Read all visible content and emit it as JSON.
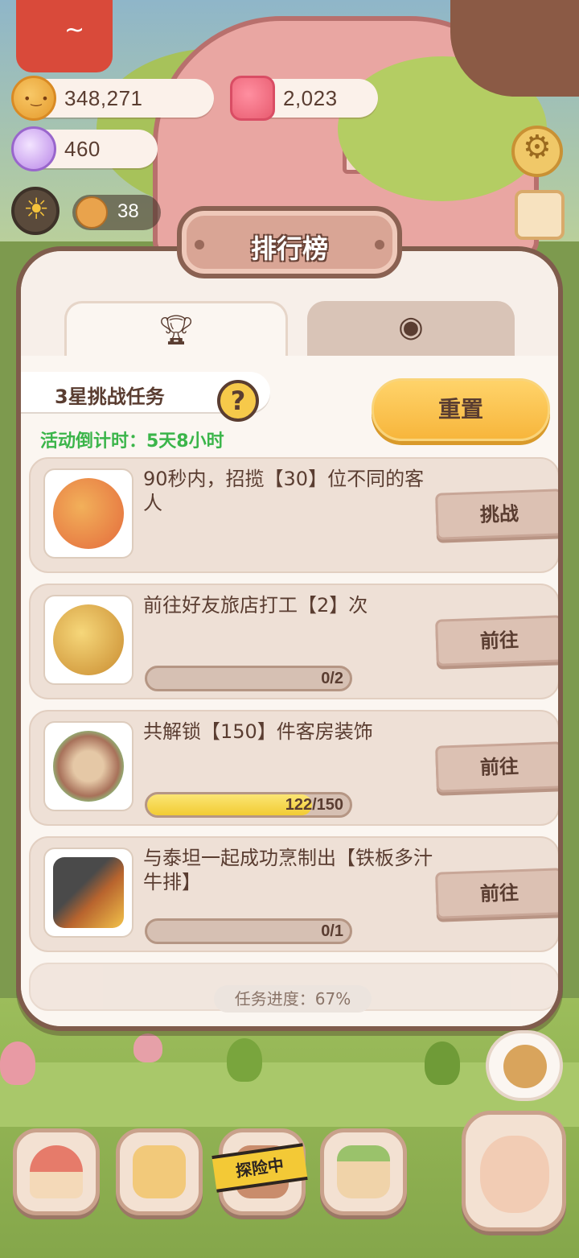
{
  "currency": {
    "cookies": "348,271",
    "candles": "2,023",
    "gems": "460"
  },
  "hud": {
    "guest_count": "38"
  },
  "modal": {
    "title": "排行榜",
    "tabs": [
      {
        "icon": "trophy-icon",
        "active": true
      },
      {
        "icon": "cookie-icon",
        "active": false
      }
    ],
    "task_header": "3星挑战任务",
    "help_label": "?",
    "countdown": "活动倒计时：5天8小时",
    "reset_label": "重置",
    "tasks": [
      {
        "desc": "90秒内，招揽【30】位不同的客人",
        "button": "挑战",
        "progress": null
      },
      {
        "desc": "前往好友旅店打工【2】次",
        "button": "前往",
        "progress": "0/2",
        "fraction": 0
      },
      {
        "desc": "共解锁【150】件客房装饰",
        "button": "前往",
        "progress": "122/150",
        "fraction": 0.8133
      },
      {
        "desc": "与泰坦一起成功烹制出【铁板多汁牛排】",
        "button": "前往",
        "progress": "0/1",
        "fraction": 0
      }
    ],
    "footer": "任务进度：67%"
  },
  "dock": {
    "adventure_label": "探险中"
  },
  "colors": {
    "accent_yellow": "#f7b63c",
    "countdown_green": "#3bb54a",
    "modal_border": "#7f5c4c"
  }
}
